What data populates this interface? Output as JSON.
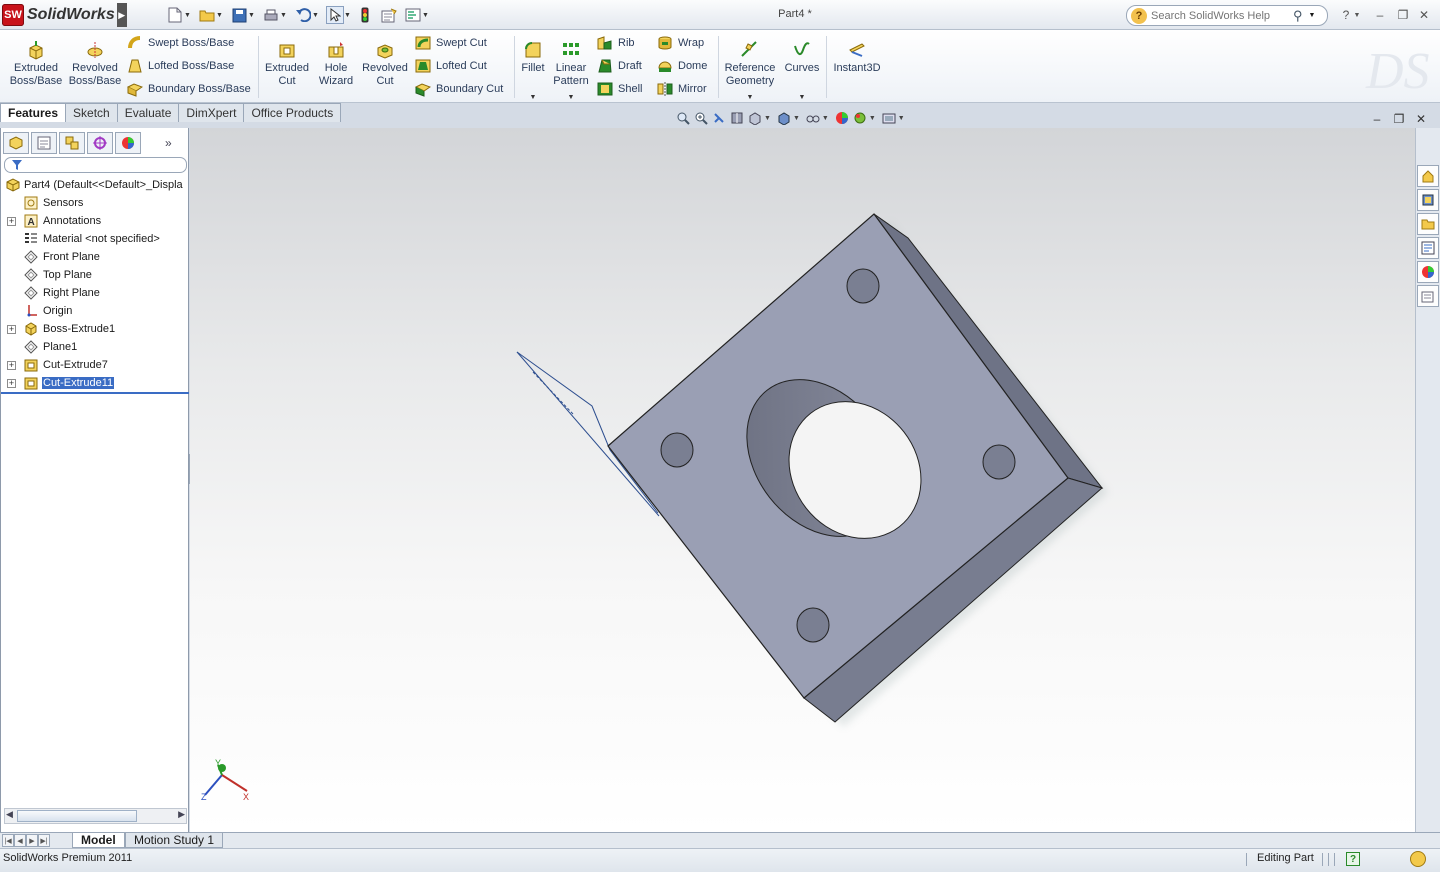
{
  "app": {
    "brand": "SolidWorks",
    "logo_text": "SW",
    "document_title": "Part4 *"
  },
  "search": {
    "placeholder": "Search SolidWorks Help"
  },
  "ribbon": {
    "extruded_boss": [
      "Extruded",
      "Boss/Base"
    ],
    "revolved_boss": [
      "Revolved",
      "Boss/Base"
    ],
    "swept_boss": "Swept Boss/Base",
    "lofted_boss": "Lofted Boss/Base",
    "boundary_boss": "Boundary Boss/Base",
    "extruded_cut": [
      "Extruded",
      "Cut"
    ],
    "hole_wizard": [
      "Hole",
      "Wizard"
    ],
    "revolved_cut": [
      "Revolved",
      "Cut"
    ],
    "swept_cut": "Swept Cut",
    "lofted_cut": "Lofted Cut",
    "boundary_cut": "Boundary Cut",
    "fillet": "Fillet",
    "linear_pattern": [
      "Linear",
      "Pattern"
    ],
    "rib": "Rib",
    "draft": "Draft",
    "shell": "Shell",
    "wrap": "Wrap",
    "dome": "Dome",
    "mirror": "Mirror",
    "reference_geometry": [
      "Reference",
      "Geometry"
    ],
    "curves": "Curves",
    "instant3d": "Instant3D"
  },
  "tabs": [
    "Features",
    "Sketch",
    "Evaluate",
    "DimXpert",
    "Office Products"
  ],
  "feature_tree": {
    "root": "Part4  (Default<<Default>_Displa",
    "items": [
      {
        "label": "Sensors",
        "icon": "sensor-icon",
        "expandable": false
      },
      {
        "label": "Annotations",
        "icon": "annotations-icon",
        "expandable": true
      },
      {
        "label": "Material <not specified>",
        "icon": "material-icon",
        "expandable": false
      },
      {
        "label": "Front Plane",
        "icon": "plane-icon",
        "expandable": false
      },
      {
        "label": "Top Plane",
        "icon": "plane-icon",
        "expandable": false
      },
      {
        "label": "Right Plane",
        "icon": "plane-icon",
        "expandable": false
      },
      {
        "label": "Origin",
        "icon": "origin-icon",
        "expandable": false
      },
      {
        "label": "Boss-Extrude1",
        "icon": "boss-extrude-icon",
        "expandable": true
      },
      {
        "label": "Plane1",
        "icon": "plane-icon",
        "expandable": false
      },
      {
        "label": "Cut-Extrude7",
        "icon": "cut-extrude-icon",
        "expandable": true
      },
      {
        "label": "Cut-Extrude11",
        "icon": "cut-extrude-icon",
        "expandable": true,
        "selected": true
      }
    ]
  },
  "triad": {
    "y": "Y",
    "x": "X",
    "z": "Z"
  },
  "bottom_tabs": [
    "Model",
    "Motion Study 1"
  ],
  "status": {
    "product": "SolidWorks Premium 2011",
    "mode": "Editing Part"
  },
  "colors": {
    "part_face": "#9a9fb4",
    "part_side": "#6f7488",
    "selection": "#3a6cc4",
    "logo_red": "#c8131b"
  }
}
